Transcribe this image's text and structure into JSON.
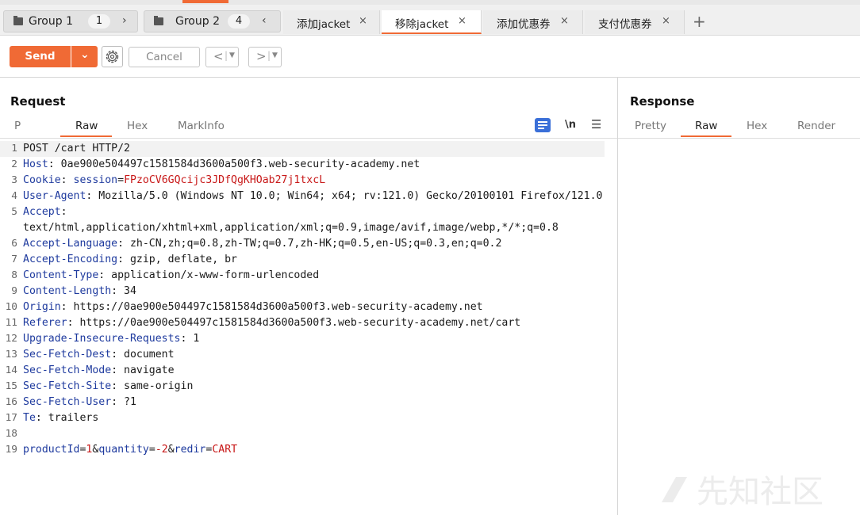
{
  "tabs_row": {
    "groups": [
      {
        "label": "Group 1",
        "count": "1",
        "arrow": "›"
      },
      {
        "label": "Group 2",
        "count": "4",
        "arrow": "‹"
      }
    ],
    "tabs": [
      {
        "label": "添加jacket",
        "close": "×"
      },
      {
        "label": "移除jacket",
        "close": "×"
      },
      {
        "label": "添加优惠券",
        "close": "×"
      },
      {
        "label": "支付优惠券",
        "close": "×"
      }
    ],
    "add_tab": "+"
  },
  "toolbar": {
    "send_label": "Send",
    "cancel_label": "Cancel",
    "back_label": "<",
    "forward_label": ">"
  },
  "request": {
    "title": "Request",
    "tabs": [
      "P",
      "Raw",
      "Hex",
      "MarkInfo"
    ],
    "newline_label": "\\n",
    "lines": [
      {
        "num": "1",
        "text": "POST /cart HTTP/2"
      },
      {
        "num": "2",
        "name": "Host",
        "value": "0ae900e504497c1581584d3600a500f3.web-security-academy.net"
      },
      {
        "num": "3",
        "name": "Cookie",
        "cookie_name": "session",
        "cookie_value": "FPzoCV6GQcijc3JDfQgKHOab27j1txcL"
      },
      {
        "num": "4",
        "name": "User-Agent",
        "value": "Mozilla/5.0 (Windows NT 10.0; Win64; x64; rv:121.0) Gecko/20100101 Firefox/121.0"
      },
      {
        "num": "5",
        "name": "Accept",
        "value": "text/html,application/xhtml+xml,application/xml;q=0.9,image/avif,image/webp,*/*;q=0.8"
      },
      {
        "num": "6",
        "name": "Accept-Language",
        "value": "zh-CN,zh;q=0.8,zh-TW;q=0.7,zh-HK;q=0.5,en-US;q=0.3,en;q=0.2"
      },
      {
        "num": "7",
        "name": "Accept-Encoding",
        "value": "gzip, deflate, br"
      },
      {
        "num": "8",
        "name": "Content-Type",
        "value": "application/x-www-form-urlencoded"
      },
      {
        "num": "9",
        "name": "Content-Length",
        "value": "34"
      },
      {
        "num": "10",
        "name": "Origin",
        "value": "https://0ae900e504497c1581584d3600a500f3.web-security-academy.net"
      },
      {
        "num": "11",
        "name": "Referer",
        "value": "https://0ae900e504497c1581584d3600a500f3.web-security-academy.net/cart"
      },
      {
        "num": "12",
        "name": "Upgrade-Insecure-Requests",
        "value": "1"
      },
      {
        "num": "13",
        "name": "Sec-Fetch-Dest",
        "value": "document"
      },
      {
        "num": "14",
        "name": "Sec-Fetch-Mode",
        "value": "navigate"
      },
      {
        "num": "15",
        "name": "Sec-Fetch-Site",
        "value": "same-origin"
      },
      {
        "num": "16",
        "name": "Sec-Fetch-User",
        "value": "?1"
      },
      {
        "num": "17",
        "name": "Te",
        "value": "trailers"
      },
      {
        "num": "18",
        "text": ""
      },
      {
        "num": "19",
        "body": [
          {
            "name": "productId",
            "value": "1"
          },
          {
            "name": "quantity",
            "value": "-2"
          },
          {
            "name": "redir",
            "value": "CART"
          }
        ]
      }
    ]
  },
  "response": {
    "title": "Response",
    "tabs": [
      "Pretty",
      "Raw",
      "Hex",
      "Render"
    ]
  },
  "watermark": "先知社区"
}
